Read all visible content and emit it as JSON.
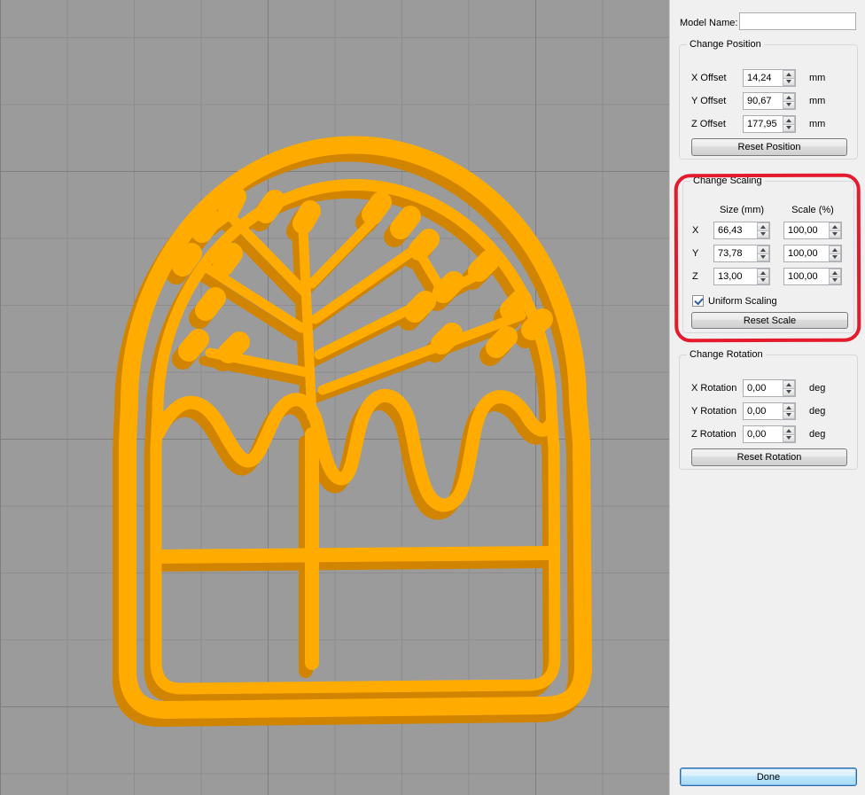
{
  "viewport": {
    "model_semantic": "easter-cake-cookie-cutter-3d-model",
    "model_color": "#ffab00",
    "model_shade_color": "#d08400",
    "background_color": "#9b9b9b"
  },
  "panel": {
    "model_name": {
      "label": "Model Name:",
      "value": ""
    },
    "position": {
      "title": "Change Position",
      "rows": [
        {
          "label": "X Offset",
          "value": "14,24",
          "unit": "mm"
        },
        {
          "label": "Y Offset",
          "value": "90,67",
          "unit": "mm"
        },
        {
          "label": "Z Offset",
          "value": "177,95",
          "unit": "mm"
        }
      ],
      "reset_label": "Reset Position"
    },
    "scaling": {
      "title": "Change Scaling",
      "col_headers": [
        "Size (mm)",
        "Scale (%)"
      ],
      "rows": [
        {
          "label": "X",
          "size": "66,43",
          "scale": "100,00"
        },
        {
          "label": "Y",
          "size": "73,78",
          "scale": "100,00"
        },
        {
          "label": "Z",
          "size": "13,00",
          "scale": "100,00"
        }
      ],
      "uniform_label": "Uniform Scaling",
      "uniform_checked": true,
      "reset_label": "Reset Scale"
    },
    "rotation": {
      "title": "Change Rotation",
      "rows": [
        {
          "label": "X Rotation",
          "value": "0,00",
          "unit": "deg"
        },
        {
          "label": "Y Rotation",
          "value": "0,00",
          "unit": "deg"
        },
        {
          "label": "Z Rotation",
          "value": "0,00",
          "unit": "deg"
        }
      ],
      "reset_label": "Reset Rotation"
    },
    "done_label": "Done"
  },
  "annotation": {
    "type": "red-highlight-box",
    "target": "change-scaling-group",
    "color": "#e41b2c"
  }
}
